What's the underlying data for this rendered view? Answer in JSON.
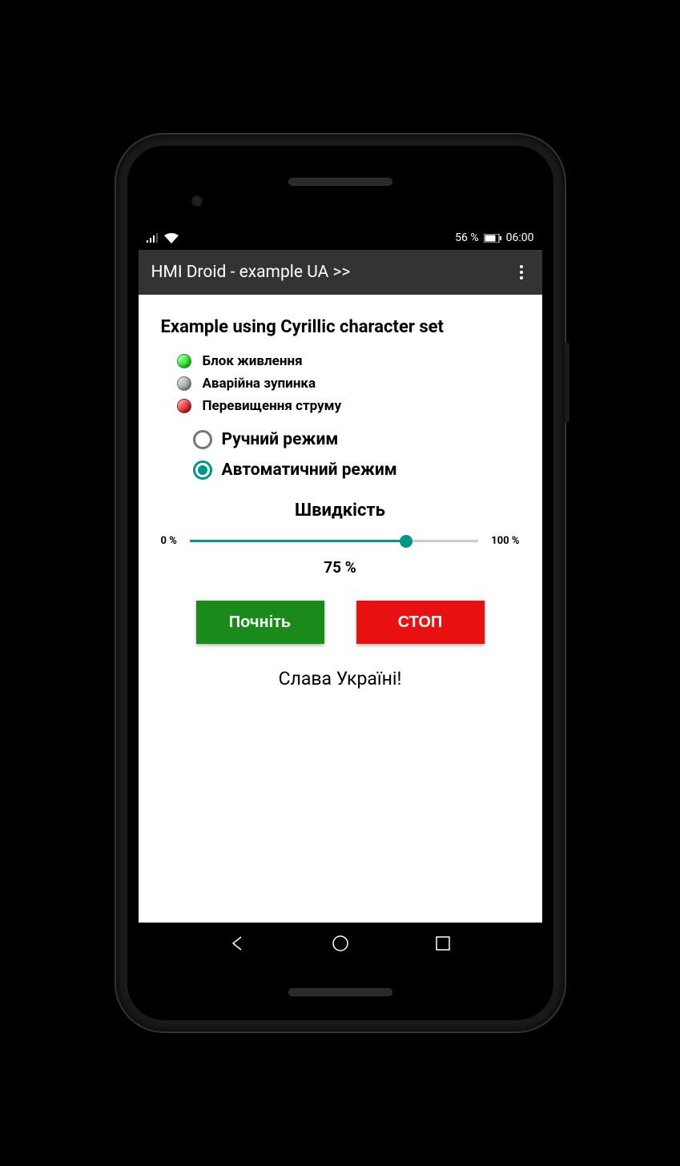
{
  "status": {
    "battery_text": "56 %",
    "time": "06:00"
  },
  "appbar": {
    "title": "HMI Droid - example UA >>"
  },
  "heading": "Example using Cyrillic character set",
  "indicators": [
    {
      "color": "green",
      "label": "Блок живлення"
    },
    {
      "color": "gray",
      "label": "Аварійна зупинка"
    },
    {
      "color": "red",
      "label": "Перевищення струму"
    }
  ],
  "radios": [
    {
      "label": "Ручний режим",
      "selected": false
    },
    {
      "label": "Автоматичний режим",
      "selected": true
    }
  ],
  "slider": {
    "title": "Швидкість",
    "min_label": "0 %",
    "max_label": "100 %",
    "value_percent": 75,
    "value_text": "75  %"
  },
  "buttons": {
    "start": "Почніть",
    "stop": "СТОП"
  },
  "footer": "Слава Україні!"
}
